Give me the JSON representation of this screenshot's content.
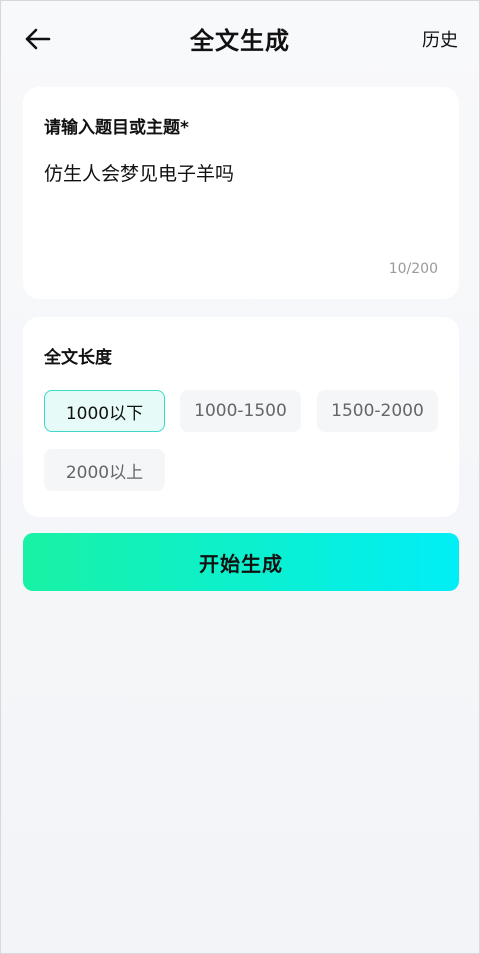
{
  "header": {
    "back_icon": "arrow-left-icon",
    "title": "全文生成",
    "history_label": "历史"
  },
  "topic": {
    "label": "请输入题目或主题*",
    "value": "仿生人会梦见电子羊吗",
    "counter": "10/200"
  },
  "length": {
    "label": "全文长度",
    "options": [
      {
        "label": "1000以下",
        "selected": true
      },
      {
        "label": "1000-1500",
        "selected": false
      },
      {
        "label": "1500-2000",
        "selected": false
      },
      {
        "label": "2000以上",
        "selected": false
      }
    ]
  },
  "start_button": {
    "label": "开始生成"
  },
  "colors": {
    "accent_start": "#19f2a4",
    "accent_end": "#00eef6",
    "selected_border": "#3ad9c8",
    "selected_bg": "#e6fbf8"
  }
}
